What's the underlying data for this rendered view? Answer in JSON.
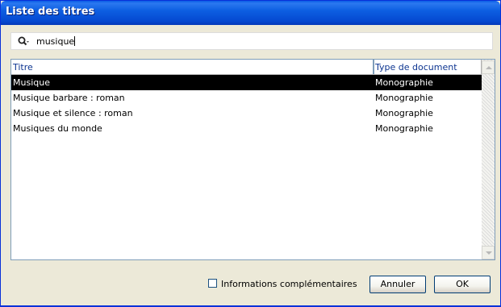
{
  "window": {
    "title": "Liste des titres"
  },
  "search": {
    "value": "musique",
    "icon": "search-icon"
  },
  "list": {
    "columns": [
      "Titre",
      "Type de document"
    ],
    "rows": [
      {
        "title": "Musique",
        "type": "Monographie",
        "selected": true
      },
      {
        "title": "Musique barbare : roman",
        "type": "Monographie",
        "selected": false
      },
      {
        "title": "Musique et silence : roman",
        "type": "Monographie",
        "selected": false
      },
      {
        "title": "Musiques du monde",
        "type": "Monographie",
        "selected": false
      }
    ]
  },
  "footer": {
    "checkbox_label": "Informations complémentaires",
    "checkbox_checked": false,
    "cancel_label": "Annuler",
    "ok_label": "OK"
  },
  "colors": {
    "title_bar": "#0a5be6",
    "selection": "#000000",
    "header_text": "#0c3490"
  }
}
